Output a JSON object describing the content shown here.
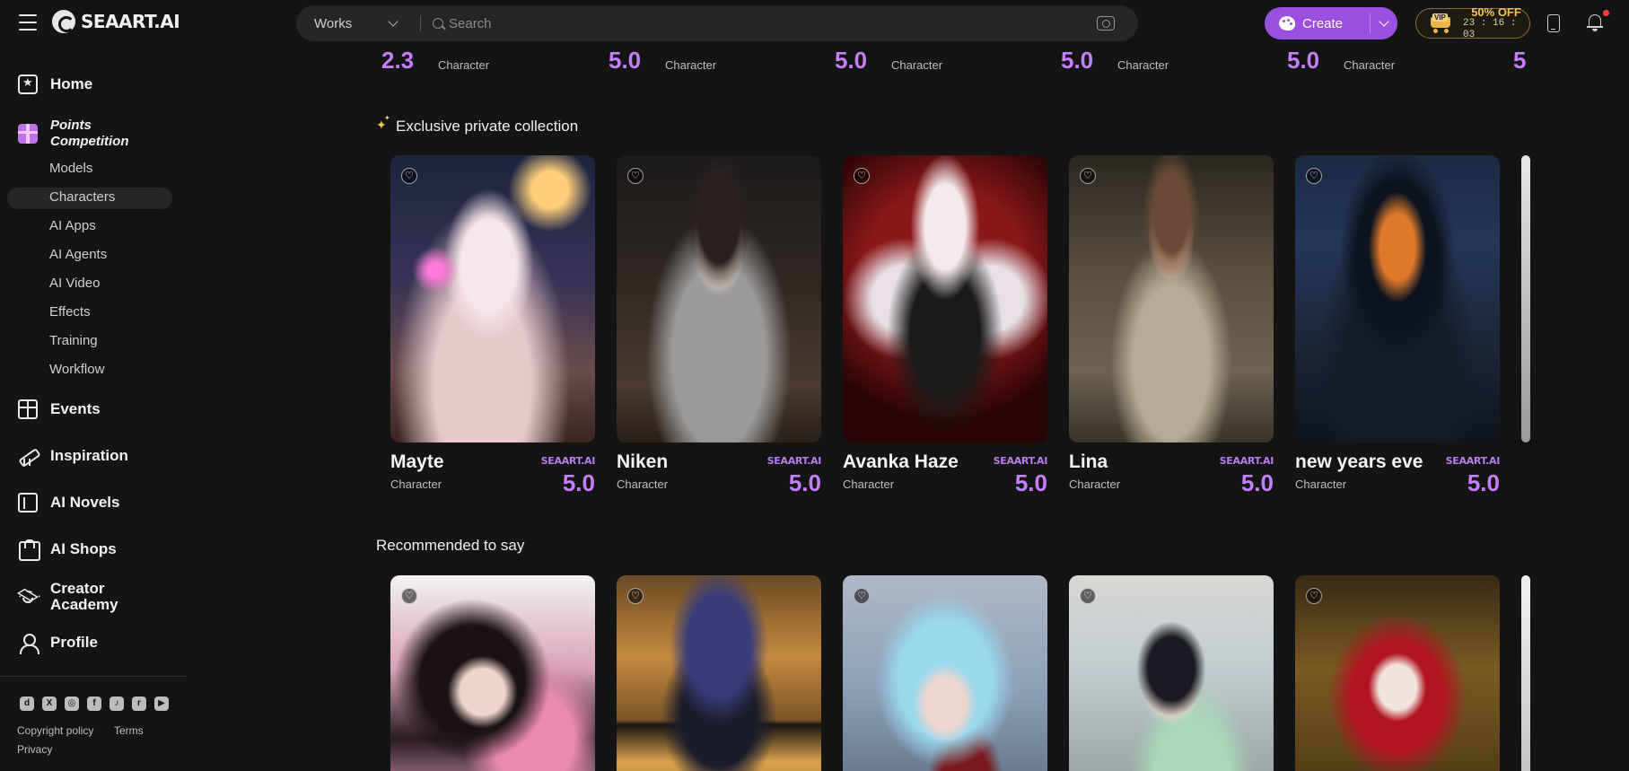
{
  "app": {
    "logo_text": "SEAART.AI"
  },
  "search": {
    "type_label": "Works",
    "placeholder": "Search"
  },
  "header": {
    "create_label": "Create",
    "vip": {
      "badge": "VIP",
      "offer": "50% OFF",
      "timer": "23 : 16 : 03"
    }
  },
  "sidebar": {
    "home": "Home",
    "points": "Points Competition",
    "sub_items": [
      "Models",
      "Characters",
      "AI Apps",
      "AI Agents",
      "AI Video",
      "Effects",
      "Training",
      "Workflow"
    ],
    "active_sub": "Characters",
    "events": "Events",
    "inspiration": "Inspiration",
    "ai_novels": "AI Novels",
    "ai_shops": "AI Shops",
    "creator_academy": "Creator Academy",
    "profile": "Profile",
    "social_icons": [
      "discord-icon",
      "x-icon",
      "instagram-icon",
      "facebook-icon",
      "tiktok-icon",
      "reddit-icon",
      "youtube-icon"
    ],
    "footer": {
      "copyright": "Copyright policy",
      "terms": "Terms",
      "privacy": "Privacy"
    }
  },
  "top_row": [
    {
      "score": "2.3",
      "kind": "Character"
    },
    {
      "score": "5.0",
      "kind": "Character"
    },
    {
      "score": "5.0",
      "kind": "Character"
    },
    {
      "score": "5.0",
      "kind": "Character"
    },
    {
      "score": "5.0",
      "kind": "Character"
    },
    {
      "score": "5",
      "kind": ""
    }
  ],
  "sections": {
    "exclusive": {
      "title": "Exclusive private collection",
      "cards": [
        {
          "name": "Mayte",
          "kind": "Character",
          "brand": "SEAART.AI",
          "score": "5.0"
        },
        {
          "name": "Niken",
          "kind": "Character",
          "brand": "SEAART.AI",
          "score": "5.0"
        },
        {
          "name": "Avanka Haze",
          "kind": "Character",
          "brand": "SEAART.AI",
          "score": "5.0"
        },
        {
          "name": "Lina",
          "kind": "Character",
          "brand": "SEAART.AI",
          "score": "5.0"
        },
        {
          "name": "new years eve",
          "kind": "Character",
          "brand": "SEAART.AI",
          "score": "5.0"
        }
      ]
    },
    "recommended": {
      "title": "Recommended to say"
    }
  },
  "colors": {
    "accent": "#9b4fe0",
    "score": "#c77dff",
    "background": "#141414",
    "vip_gold": "#f2c35a"
  }
}
